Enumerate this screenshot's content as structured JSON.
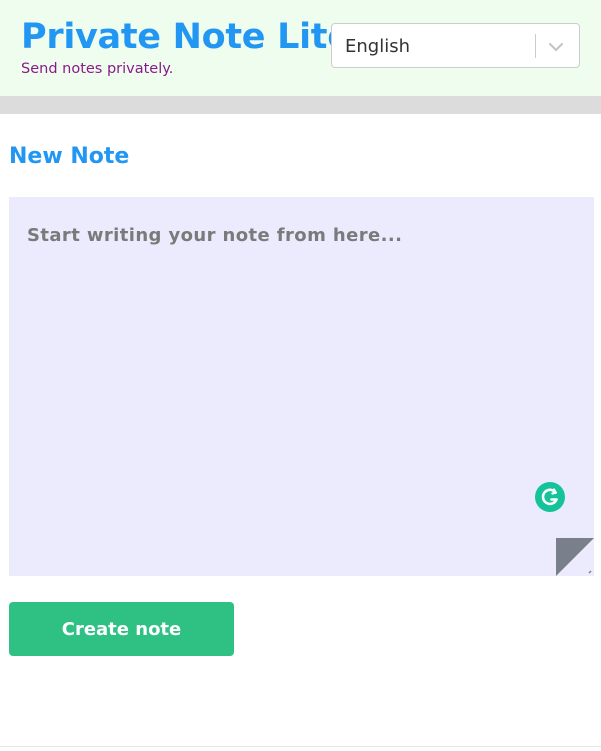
{
  "header": {
    "title": "Private Note Lite",
    "tagline": "Send notes privately.",
    "language_select": {
      "value": "English",
      "icon": "chevron-down-icon"
    }
  },
  "editor": {
    "section_title": "New Note",
    "value": "",
    "placeholder": "Start writing your note from here...",
    "grammarly_icon": "grammarly-icon",
    "resize_icon": "resize-handle-icon"
  },
  "actions": {
    "create_label": "Create note"
  },
  "colors": {
    "header_bg": "#effdef",
    "brand_blue": "#2196f3",
    "tagline_purple": "#8a1a8a",
    "editor_bg": "#ecebfd",
    "button_green": "#2ec183",
    "grammarly_green": "#15c39a"
  }
}
